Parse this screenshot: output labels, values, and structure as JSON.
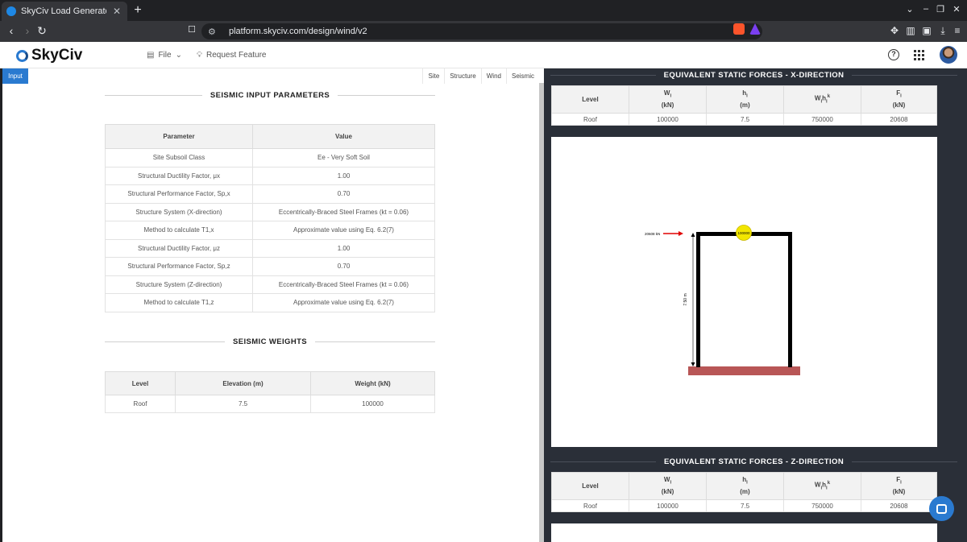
{
  "browser": {
    "tab_title": "SkyCiv Load Generator | S",
    "url": "platform.skyciv.com/design/wind/v2"
  },
  "header": {
    "logo_text": "SkyCiv",
    "file_menu": "File",
    "request_feature": "Request Feature"
  },
  "left": {
    "input_tab": "Input",
    "subtabs": [
      "Site",
      "Structure",
      "Wind",
      "Seismic"
    ],
    "params_title": "SEISMIC INPUT PARAMETERS",
    "params_headers": [
      "Parameter",
      "Value"
    ],
    "params_rows": [
      {
        "param": "Site Subsoil Class",
        "value": "Ee - Very Soft Soil"
      },
      {
        "param": "Structural Ductility Factor, μx",
        "value": "1.00"
      },
      {
        "param": "Structural Performance Factor, Sp,x",
        "value": "0.70"
      },
      {
        "param": "Structure System (X-direction)",
        "value": "Eccentrically-Braced Steel Frames (kt = 0.06)"
      },
      {
        "param": "Method to calculate T1,x",
        "value": "Approximate value using Eq. 6.2(7)"
      },
      {
        "param": "Structural Ductility Factor, μz",
        "value": "1.00"
      },
      {
        "param": "Structural Performance Factor, Sp,z",
        "value": "0.70"
      },
      {
        "param": "Structure System (Z-direction)",
        "value": "Eccentrically-Braced Steel Frames (kt = 0.06)"
      },
      {
        "param": "Method to calculate T1,z",
        "value": "Approximate value using Eq. 6.2(7)"
      }
    ],
    "weights_title": "SEISMIC WEIGHTS",
    "weights_headers": [
      "Level",
      "Elevation (m)",
      "Weight (kN)"
    ],
    "weights_rows": [
      {
        "level": "Roof",
        "elevation": "7.5",
        "weight": "100000"
      }
    ]
  },
  "right": {
    "x_title": "EQUIVALENT STATIC FORCES - X-DIRECTION",
    "z_title": "EQUIVALENT STATIC FORCES - Z-DIRECTION",
    "force_headers": {
      "level": "Level",
      "wi": "Wi",
      "wi_unit": "(kN)",
      "hi": "hi",
      "hi_unit": "(m)",
      "wihk": "Wihik",
      "fi": "Fi",
      "fi_unit": "(kN)"
    },
    "x_rows": [
      {
        "level": "Roof",
        "wi": "100000",
        "hi": "7.5",
        "wihk": "750000",
        "fi": "20608"
      }
    ],
    "z_rows": [
      {
        "level": "Roof",
        "wi": "100000",
        "hi": "7.5",
        "wihk": "750000",
        "fi": "20608"
      }
    ],
    "diagram": {
      "force_label": "20608 kN",
      "mass_label": "100000",
      "height_label": "7.50 m",
      "frame_color": "#000000",
      "base_color": "#b85656",
      "mass_color": "#f2e600",
      "arrow_color": "#e00000"
    }
  },
  "colors": {
    "accent": "#2a7ad0",
    "dark_panel": "#2a2f38"
  }
}
